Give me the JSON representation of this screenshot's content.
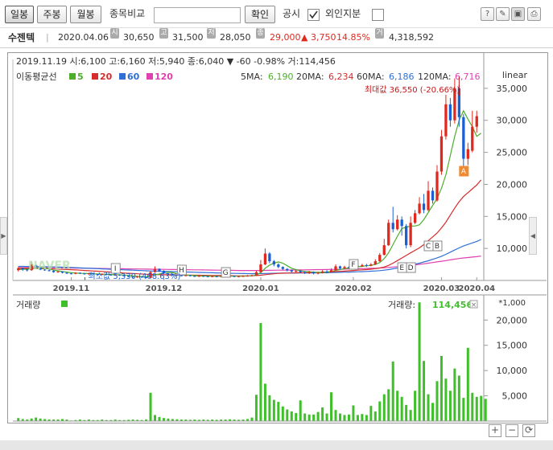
{
  "toolbar": {
    "tabs": [
      "일봉",
      "주봉",
      "월봉"
    ],
    "compare_label": "종목비교",
    "confirm_label": "확인",
    "notice_label": "공시",
    "foreign_label": "외인지분"
  },
  "stock": {
    "name": "수젠텍",
    "date": "2020.04.06",
    "open_tag": "시",
    "open": "30,650",
    "high_tag": "고",
    "high": "31,500",
    "low_tag": "저",
    "low": "28,050",
    "close_tag": "종",
    "close": "29,000",
    "change": "▲ 3,750",
    "change_pct": "14.85%",
    "volume_tag": "거",
    "volume": "4,318,592"
  },
  "colors": {
    "up": "#e1281e",
    "down": "#1a5fd6",
    "ma5": "#4caf2a",
    "ma20": "#d62c2c",
    "ma60": "#2f6fd6",
    "ma120": "#e040b0",
    "volume": "#3fbf2a"
  },
  "chart_data": {
    "type": "line",
    "info_line": "2019.11.19 시:6,100 고:6,160 저:5,940 종:6,040 ▼ -60 -0.98% 거:114,456",
    "legend_title": "이동평균선",
    "legend": [
      {
        "name": "5",
        "color": "#4caf2a"
      },
      {
        "name": "20",
        "color": "#d62c2c"
      },
      {
        "name": "60",
        "color": "#2f6fd6"
      },
      {
        "name": "120",
        "color": "#e040b0"
      }
    ],
    "ma_values": [
      {
        "label": "5MA:",
        "value": "6,190"
      },
      {
        "label": "20MA:",
        "value": "6,234"
      },
      {
        "label": "60MA:",
        "value": "6,186"
      },
      {
        "label": "120MA:",
        "value": "6,716"
      }
    ],
    "scale": "linear",
    "y_ticks": [
      "35,000",
      "30,000",
      "25,000",
      "20,000",
      "15,000",
      "10,000"
    ],
    "y_tick_values": [
      35000,
      30000,
      25000,
      20000,
      15000,
      10000
    ],
    "ylim": [
      5000,
      38500
    ],
    "x_ticks": [
      "2019.11",
      "2019.12",
      "2020.01",
      "2020.02",
      "2020.03",
      "2020.04"
    ],
    "max_label": "최대값 36,550 (-20.66%)",
    "min_label": "최소값 5,330 (468.63%)",
    "markers": [
      "I",
      "H",
      "G",
      "F",
      "E",
      "D",
      "C",
      "B",
      "A"
    ],
    "candles": [
      {
        "o": 6600,
        "c": 6900,
        "h": 7100,
        "l": 6400
      },
      {
        "o": 6900,
        "c": 6700,
        "h": 7000,
        "l": 6500
      },
      {
        "o": 6700,
        "c": 6600,
        "h": 6800,
        "l": 6400
      },
      {
        "o": 6600,
        "c": 7500,
        "h": 8000,
        "l": 6500
      },
      {
        "o": 7400,
        "c": 7000,
        "h": 7500,
        "l": 6800
      },
      {
        "o": 7000,
        "c": 6700,
        "h": 7100,
        "l": 6600
      },
      {
        "o": 6700,
        "c": 6600,
        "h": 6800,
        "l": 6500
      },
      {
        "o": 6600,
        "c": 6500,
        "h": 6700,
        "l": 6400
      },
      {
        "o": 6500,
        "c": 6300,
        "h": 6600,
        "l": 6200
      },
      {
        "o": 6300,
        "c": 6400,
        "h": 6500,
        "l": 6200
      },
      {
        "o": 6400,
        "c": 6200,
        "h": 6450,
        "l": 6100
      },
      {
        "o": 6200,
        "c": 6100,
        "h": 6300,
        "l": 6000
      },
      {
        "o": 6100,
        "c": 6040,
        "h": 6160,
        "l": 5940
      },
      {
        "o": 6040,
        "c": 6200,
        "h": 6300,
        "l": 5950
      },
      {
        "o": 6200,
        "c": 6100,
        "h": 6250,
        "l": 6000
      },
      {
        "o": 6100,
        "c": 6000,
        "h": 6150,
        "l": 5900
      },
      {
        "o": 6000,
        "c": 6100,
        "h": 6200,
        "l": 5900
      },
      {
        "o": 6100,
        "c": 6000,
        "h": 6150,
        "l": 5900
      },
      {
        "o": 6000,
        "c": 5950,
        "h": 6050,
        "l": 5850
      },
      {
        "o": 5950,
        "c": 6000,
        "h": 6100,
        "l": 5850
      },
      {
        "o": 6000,
        "c": 5900,
        "h": 6050,
        "l": 5800
      },
      {
        "o": 5900,
        "c": 5850,
        "h": 5950,
        "l": 5750
      },
      {
        "o": 5850,
        "c": 5900,
        "h": 6000,
        "l": 5750
      },
      {
        "o": 5900,
        "c": 5800,
        "h": 5950,
        "l": 5700
      },
      {
        "o": 5800,
        "c": 5700,
        "h": 5850,
        "l": 5600
      },
      {
        "o": 5700,
        "c": 5600,
        "h": 5750,
        "l": 5500
      },
      {
        "o": 5600,
        "c": 5500,
        "h": 5650,
        "l": 5400
      },
      {
        "o": 5500,
        "c": 5600,
        "h": 5700,
        "l": 5400
      },
      {
        "o": 5600,
        "c": 5500,
        "h": 5650,
        "l": 5400
      },
      {
        "o": 5500,
        "c": 5400,
        "h": 5550,
        "l": 5330
      },
      {
        "o": 5400,
        "c": 6300,
        "h": 6500,
        "l": 5350
      },
      {
        "o": 6300,
        "c": 6800,
        "h": 7200,
        "l": 6200
      },
      {
        "o": 6800,
        "c": 6500,
        "h": 6900,
        "l": 6300
      },
      {
        "o": 6500,
        "c": 6100,
        "h": 6600,
        "l": 6000
      },
      {
        "o": 6100,
        "c": 6000,
        "h": 6200,
        "l": 5900
      },
      {
        "o": 6000,
        "c": 5900,
        "h": 6050,
        "l": 5800
      },
      {
        "o": 5900,
        "c": 5800,
        "h": 5950,
        "l": 5700
      },
      {
        "o": 5800,
        "c": 5750,
        "h": 5900,
        "l": 5650
      },
      {
        "o": 5750,
        "c": 5800,
        "h": 5900,
        "l": 5650
      },
      {
        "o": 5800,
        "c": 5700,
        "h": 5850,
        "l": 5600
      },
      {
        "o": 5700,
        "c": 5650,
        "h": 5750,
        "l": 5550
      },
      {
        "o": 5650,
        "c": 5700,
        "h": 5800,
        "l": 5550
      },
      {
        "o": 5700,
        "c": 5650,
        "h": 5750,
        "l": 5550
      },
      {
        "o": 5650,
        "c": 5600,
        "h": 5700,
        "l": 5500
      },
      {
        "o": 5600,
        "c": 5650,
        "h": 5750,
        "l": 5500
      },
      {
        "o": 5650,
        "c": 5600,
        "h": 5700,
        "l": 5500
      },
      {
        "o": 5600,
        "c": 5700,
        "h": 5800,
        "l": 5500
      },
      {
        "o": 5700,
        "c": 5650,
        "h": 5750,
        "l": 5550
      },
      {
        "o": 5650,
        "c": 5700,
        "h": 5800,
        "l": 5550
      },
      {
        "o": 5700,
        "c": 5600,
        "h": 5750,
        "l": 5500
      },
      {
        "o": 5600,
        "c": 5650,
        "h": 5700,
        "l": 5500
      },
      {
        "o": 5650,
        "c": 5700,
        "h": 5800,
        "l": 5550
      },
      {
        "o": 5700,
        "c": 5750,
        "h": 5850,
        "l": 5600
      },
      {
        "o": 5750,
        "c": 5800,
        "h": 5900,
        "l": 5650
      },
      {
        "o": 5800,
        "c": 6300,
        "h": 6500,
        "l": 5750
      },
      {
        "o": 6300,
        "c": 7500,
        "h": 8200,
        "l": 6200
      },
      {
        "o": 7500,
        "c": 9200,
        "h": 10000,
        "l": 7400
      },
      {
        "o": 9200,
        "c": 8000,
        "h": 9400,
        "l": 7700
      },
      {
        "o": 8000,
        "c": 7500,
        "h": 8200,
        "l": 7200
      },
      {
        "o": 7500,
        "c": 7100,
        "h": 7700,
        "l": 6900
      },
      {
        "o": 7100,
        "c": 6800,
        "h": 7200,
        "l": 6600
      },
      {
        "o": 6800,
        "c": 6600,
        "h": 6900,
        "l": 6400
      },
      {
        "o": 6600,
        "c": 6400,
        "h": 6700,
        "l": 6200
      },
      {
        "o": 6400,
        "c": 6500,
        "h": 6700,
        "l": 6200
      },
      {
        "o": 6500,
        "c": 6300,
        "h": 6600,
        "l": 6100
      },
      {
        "o": 6300,
        "c": 6200,
        "h": 6400,
        "l": 6000
      },
      {
        "o": 6200,
        "c": 6300,
        "h": 6500,
        "l": 6000
      },
      {
        "o": 6300,
        "c": 6100,
        "h": 6400,
        "l": 5950
      },
      {
        "o": 6100,
        "c": 6200,
        "h": 6350,
        "l": 5950
      },
      {
        "o": 6200,
        "c": 6400,
        "h": 6600,
        "l": 6100
      },
      {
        "o": 6400,
        "c": 6300,
        "h": 6600,
        "l": 6100
      },
      {
        "o": 6300,
        "c": 6600,
        "h": 6900,
        "l": 6200
      },
      {
        "o": 6600,
        "c": 7200,
        "h": 7500,
        "l": 6500
      },
      {
        "o": 7200,
        "c": 6900,
        "h": 7300,
        "l": 6700
      },
      {
        "o": 6900,
        "c": 7100,
        "h": 7300,
        "l": 6800
      },
      {
        "o": 7100,
        "c": 7000,
        "h": 7200,
        "l": 6800
      },
      {
        "o": 7000,
        "c": 7300,
        "h": 7600,
        "l": 6900
      },
      {
        "o": 7300,
        "c": 7200,
        "h": 7500,
        "l": 7000
      },
      {
        "o": 7200,
        "c": 7400,
        "h": 7600,
        "l": 7100
      },
      {
        "o": 7400,
        "c": 7300,
        "h": 7600,
        "l": 7100
      },
      {
        "o": 7300,
        "c": 7500,
        "h": 7700,
        "l": 7200
      },
      {
        "o": 7500,
        "c": 8000,
        "h": 8300,
        "l": 7400
      },
      {
        "o": 8000,
        "c": 9000,
        "h": 9300,
        "l": 7900
      },
      {
        "o": 9000,
        "c": 10500,
        "h": 11500,
        "l": 8900
      },
      {
        "o": 10500,
        "c": 14000,
        "h": 14500,
        "l": 10400
      },
      {
        "o": 14000,
        "c": 13000,
        "h": 16500,
        "l": 12500
      },
      {
        "o": 13000,
        "c": 14500,
        "h": 15200,
        "l": 12800
      },
      {
        "o": 14500,
        "c": 13500,
        "h": 15000,
        "l": 12000
      },
      {
        "o": 13500,
        "c": 10500,
        "h": 13800,
        "l": 10000
      },
      {
        "o": 10500,
        "c": 14000,
        "h": 15000,
        "l": 10200
      },
      {
        "o": 14000,
        "c": 15500,
        "h": 16000,
        "l": 13800
      },
      {
        "o": 15500,
        "c": 17000,
        "h": 18000,
        "l": 15300
      },
      {
        "o": 17000,
        "c": 16000,
        "h": 18500,
        "l": 15500
      },
      {
        "o": 16000,
        "c": 19000,
        "h": 20500,
        "l": 15800
      },
      {
        "o": 19000,
        "c": 17500,
        "h": 19500,
        "l": 17000
      },
      {
        "o": 17500,
        "c": 22000,
        "h": 23000,
        "l": 17300
      },
      {
        "o": 22000,
        "c": 27500,
        "h": 28500,
        "l": 21500
      },
      {
        "o": 27500,
        "c": 32500,
        "h": 34000,
        "l": 27000
      },
      {
        "o": 32500,
        "c": 30000,
        "h": 33500,
        "l": 29000
      },
      {
        "o": 30000,
        "c": 35000,
        "h": 36550,
        "l": 29500
      },
      {
        "o": 35000,
        "c": 30500,
        "h": 35500,
        "l": 29000
      },
      {
        "o": 30500,
        "c": 24000,
        "h": 31000,
        "l": 22500
      },
      {
        "o": 24000,
        "c": 25500,
        "h": 26500,
        "l": 23000
      },
      {
        "o": 25250,
        "c": 29000,
        "h": 31500,
        "l": 25000
      },
      {
        "o": 29000,
        "c": 30650,
        "h": 31500,
        "l": 28050
      }
    ],
    "ma5": [
      6700,
      6750,
      6760,
      6850,
      6900,
      6950,
      6900,
      6800,
      6600,
      6500,
      6380,
      6300,
      6200,
      6150,
      6120,
      6100,
      6070,
      6050,
      6010,
      5990,
      5960,
      5930,
      5900,
      5880,
      5840,
      5770,
      5700,
      5640,
      5600,
      5560,
      5700,
      5900,
      6000,
      6200,
      6300,
      6200,
      6050,
      5900,
      5830,
      5790,
      5750,
      5720,
      5700,
      5680,
      5660,
      5640,
      5650,
      5650,
      5660,
      5670,
      5660,
      5670,
      5690,
      5720,
      5850,
      6200,
      6900,
      7400,
      7700,
      7900,
      7700,
      7300,
      6900,
      6700,
      6500,
      6400,
      6350,
      6300,
      6250,
      6250,
      6300,
      6400,
      6550,
      6700,
      6850,
      6950,
      7050,
      7150,
      7200,
      7300,
      7350,
      7500,
      7800,
      8400,
      9300,
      10600,
      11900,
      13100,
      13300,
      13500,
      13500,
      13700,
      14500,
      15600,
      16700,
      17800,
      19400,
      21500,
      24500,
      27500,
      30000,
      31500,
      30200,
      29000,
      27500,
      28000
    ],
    "ma20": [
      6900,
      6900,
      6890,
      6880,
      6870,
      6860,
      6840,
      6820,
      6800,
      6770,
      6740,
      6710,
      6680,
      6640,
      6600,
      6560,
      6520,
      6480,
      6440,
      6400,
      6350,
      6300,
      6250,
      6200,
      6160,
      6120,
      6080,
      6040,
      6000,
      5960,
      5940,
      5920,
      5900,
      5890,
      5880,
      5870,
      5860,
      5850,
      5840,
      5830,
      5820,
      5810,
      5800,
      5790,
      5780,
      5770,
      5760,
      5750,
      5740,
      5730,
      5720,
      5720,
      5720,
      5730,
      5760,
      5820,
      5900,
      5980,
      6050,
      6100,
      6130,
      6150,
      6170,
      6190,
      6200,
      6210,
      6220,
      6234,
      6250,
      6270,
      6300,
      6340,
      6380,
      6420,
      6460,
      6500,
      6550,
      6600,
      6650,
      6700,
      6760,
      6840,
      6950,
      7100,
      7350,
      7700,
      8100,
      8500,
      8900,
      9300,
      9700,
      10100,
      10600,
      11200,
      11800,
      12400,
      13200,
      14100,
      15200,
      16300,
      17300,
      18100,
      18700,
      19300,
      19900,
      20700
    ],
    "ma60": [
      7200,
      7190,
      7180,
      7170,
      7160,
      7150,
      7140,
      7130,
      7110,
      7090,
      7070,
      7050,
      7020,
      6990,
      6960,
      6930,
      6900,
      6870,
      6840,
      6810,
      6780,
      6750,
      6720,
      6690,
      6660,
      6630,
      6600,
      6570,
      6540,
      6510,
      6480,
      6460,
      6440,
      6420,
      6400,
      6380,
      6360,
      6340,
      6320,
      6300,
      6280,
      6260,
      6240,
      6220,
      6200,
      6180,
      6160,
      6140,
      6120,
      6100,
      6090,
      6080,
      6070,
      6060,
      6060,
      6070,
      6090,
      6110,
      6120,
      6130,
      6140,
      6150,
      6155,
      6160,
      6165,
      6170,
      6175,
      6180,
      6186,
      6195,
      6210,
      6230,
      6250,
      6270,
      6290,
      6310,
      6330,
      6350,
      6380,
      6410,
      6440,
      6480,
      6530,
      6600,
      6700,
      6820,
      6950,
      7100,
      7250,
      7400,
      7550,
      7700,
      7880,
      8080,
      8300,
      8520,
      8780,
      9080,
      9420,
      9760,
      10080,
      10380,
      10620,
      10860,
      11100,
      11400
    ],
    "ma120": [
      7000,
      7000,
      7000,
      7000,
      7000,
      6990,
      6990,
      6980,
      6980,
      6970,
      6960,
      6950,
      6940,
      6930,
      6920,
      6910,
      6900,
      6890,
      6880,
      6870,
      6860,
      6850,
      6840,
      6830,
      6820,
      6810,
      6800,
      6790,
      6780,
      6770,
      6760,
      6750,
      6740,
      6730,
      6720,
      6710,
      6700,
      6690,
      6680,
      6670,
      6660,
      6650,
      6640,
      6630,
      6620,
      6610,
      6600,
      6590,
      6580,
      6570,
      6560,
      6550,
      6550,
      6550,
      6550,
      6560,
      6570,
      6580,
      6590,
      6600,
      6610,
      6620,
      6630,
      6640,
      6650,
      6660,
      6670,
      6680,
      6690,
      6700,
      6710,
      6716,
      6730,
      6750,
      6770,
      6790,
      6810,
      6830,
      6850,
      6870,
      6890,
      6910,
      6940,
      6980,
      7030,
      7090,
      7160,
      7230,
      7300,
      7370,
      7440,
      7510,
      7600,
      7700,
      7800,
      7900,
      8000,
      8100,
      8210,
      8320,
      8420,
      8510,
      8580,
      8650,
      8720,
      8800
    ],
    "volume_panel": {
      "title": "거래량",
      "unit": "*1,000",
      "value_label": "거래량:",
      "value": "114,456",
      "y_ticks": [
        "20,000",
        "15,000",
        "10,000",
        "5,000"
      ],
      "y_tick_values": [
        20000,
        15000,
        10000,
        5000
      ],
      "ylim": [
        0,
        24500
      ],
      "values": [
        600,
        400,
        300,
        500,
        700,
        500,
        400,
        300,
        300,
        300,
        400,
        300,
        114,
        200,
        300,
        200,
        300,
        200,
        200,
        300,
        200,
        200,
        300,
        200,
        200,
        250,
        300,
        250,
        200,
        300,
        5600,
        1200,
        800,
        600,
        500,
        400,
        350,
        300,
        300,
        250,
        300,
        250,
        300,
        250,
        300,
        250,
        300,
        300,
        350,
        300,
        250,
        300,
        400,
        700,
        5200,
        19400,
        7400,
        5100,
        4200,
        3800,
        2900,
        2300,
        1900,
        1600,
        4100,
        1500,
        1300,
        1300,
        1800,
        2700,
        1500,
        5700,
        2200,
        1500,
        1200,
        1300,
        3100,
        1200,
        1400,
        1200,
        3000,
        1900,
        3900,
        5300,
        6300,
        11800,
        6000,
        4800,
        3200,
        2200,
        6000,
        23500,
        11900,
        5300,
        3600,
        7900,
        12900,
        8400,
        6000,
        10400,
        9000,
        4600,
        14500,
        5600,
        4800,
        5000,
        4400
      ]
    }
  }
}
